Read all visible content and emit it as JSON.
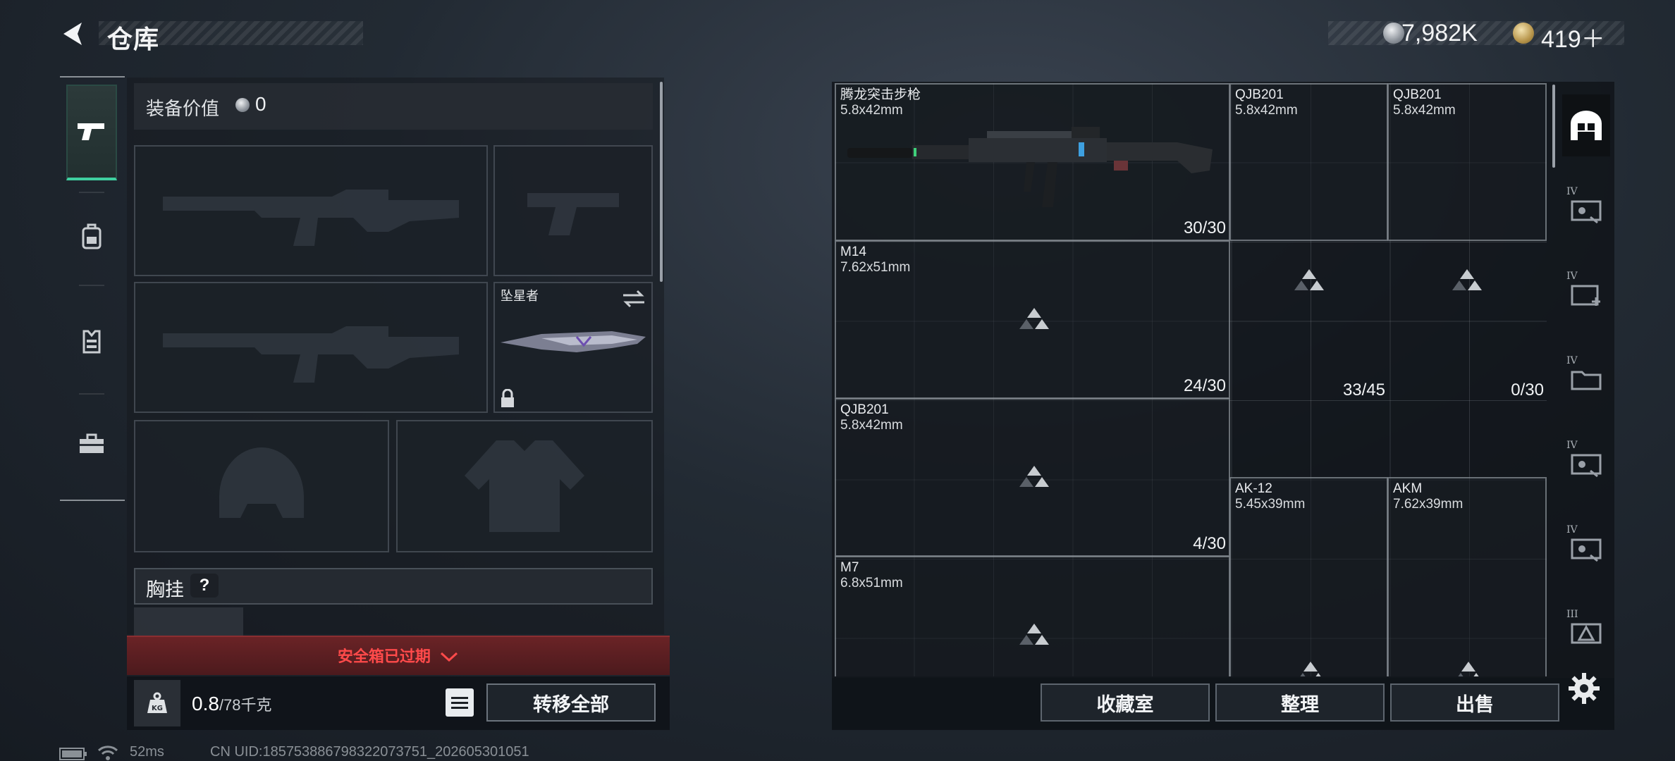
{
  "header": {
    "title": "仓库"
  },
  "currency": {
    "silver": "7,982K",
    "gold": "419＋"
  },
  "nav": {
    "items": [
      {
        "name": "weapons",
        "icon": "pistol-icon",
        "active": true
      },
      {
        "name": "backpack",
        "icon": "backpack-icon",
        "active": false
      },
      {
        "name": "vest",
        "icon": "vest-icon",
        "active": false
      },
      {
        "name": "toolbox",
        "icon": "toolbox-icon",
        "active": false
      }
    ]
  },
  "equipment": {
    "value_label": "装备价值",
    "value": "0",
    "melee_name": "坠星者",
    "chest_label": "胸挂",
    "chest_help": "?",
    "safebox_status": "安全箱已过期",
    "weight_current": "0.8",
    "weight_max": "/78千克",
    "transfer_all": "转移全部"
  },
  "grid_items": [
    {
      "name": "腾龙突击步枪",
      "caliber": "5.8x42mm",
      "ammo": "30/30"
    },
    {
      "name": "QJB201",
      "caliber": "5.8x42mm",
      "ammo": ""
    },
    {
      "name": "QJB201",
      "caliber": "5.8x42mm",
      "ammo": ""
    },
    {
      "name": "M14",
      "caliber": "7.62x51mm",
      "ammo": "24/30"
    },
    {
      "name": "",
      "caliber": "",
      "ammo": "33/45"
    },
    {
      "name": "",
      "caliber": "",
      "ammo": "0/30"
    },
    {
      "name": "QJB201",
      "caliber": "5.8x42mm",
      "ammo": "4/30"
    },
    {
      "name": "AK-12",
      "caliber": "5.45x39mm",
      "ammo": ""
    },
    {
      "name": "AKM",
      "caliber": "7.62x39mm",
      "ammo": ""
    },
    {
      "name": "M7",
      "caliber": "6.8x51mm",
      "ammo": ""
    }
  ],
  "footer_buttons": {
    "collection": "收藏室",
    "organize": "整理",
    "sell": "出售"
  },
  "side_tabs": [
    {
      "icon": "storage-home-icon",
      "roman": ""
    },
    {
      "icon": "storage-iv-icon",
      "roman": "IV"
    },
    {
      "icon": "storage-iv-icon",
      "roman": "IV"
    },
    {
      "icon": "storage-iv-icon",
      "roman": "IV"
    },
    {
      "icon": "storage-iv-icon",
      "roman": "IV"
    },
    {
      "icon": "storage-iv-icon",
      "roman": "IV"
    },
    {
      "icon": "storage-iii-icon",
      "roman": "III"
    }
  ],
  "status": {
    "ping": "52ms",
    "uid": "CN UID:1857538867983220737​51_202605301051"
  }
}
